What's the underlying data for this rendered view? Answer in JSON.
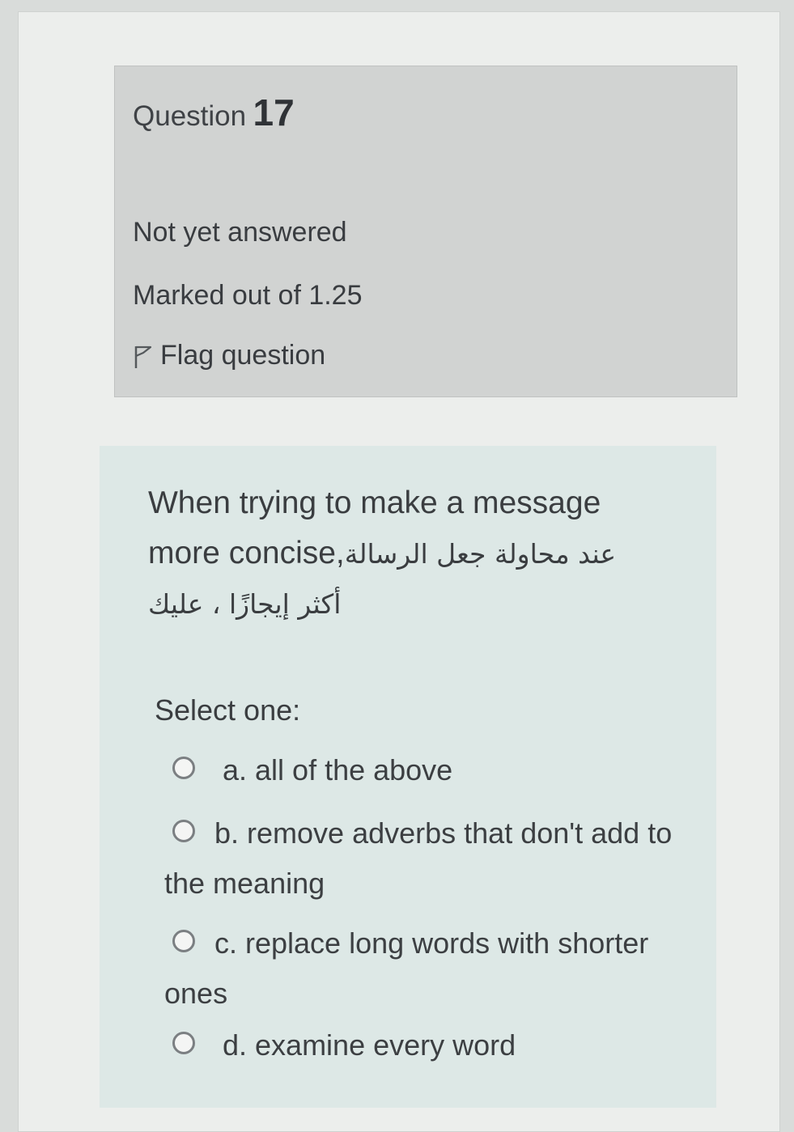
{
  "question": {
    "label": "Question",
    "number": "17",
    "state": "Not yet answered",
    "grade": "Marked out of 1.25",
    "flag_label": "Flag question",
    "flag_icon": "flag-icon"
  },
  "content": {
    "text_en": "When trying to make a message more concise,",
    "text_ar_1": "عند محاولة جعل الرسالة",
    "text_ar_2": "أكثر إيجازًا ، عليك",
    "prompt": "Select one:",
    "options": [
      {
        "label": "a. all of the above",
        "selected": false
      },
      {
        "label": "b. remove adverbs that don't add to the meaning",
        "selected": false
      },
      {
        "label": "c. replace long words with shorter ones",
        "selected": false
      },
      {
        "label": "d. examine every word",
        "selected": false
      }
    ]
  },
  "colors": {
    "info_bg": "#d1d3d2",
    "content_bg": "#dde8e6",
    "text": "#3c3f42"
  }
}
